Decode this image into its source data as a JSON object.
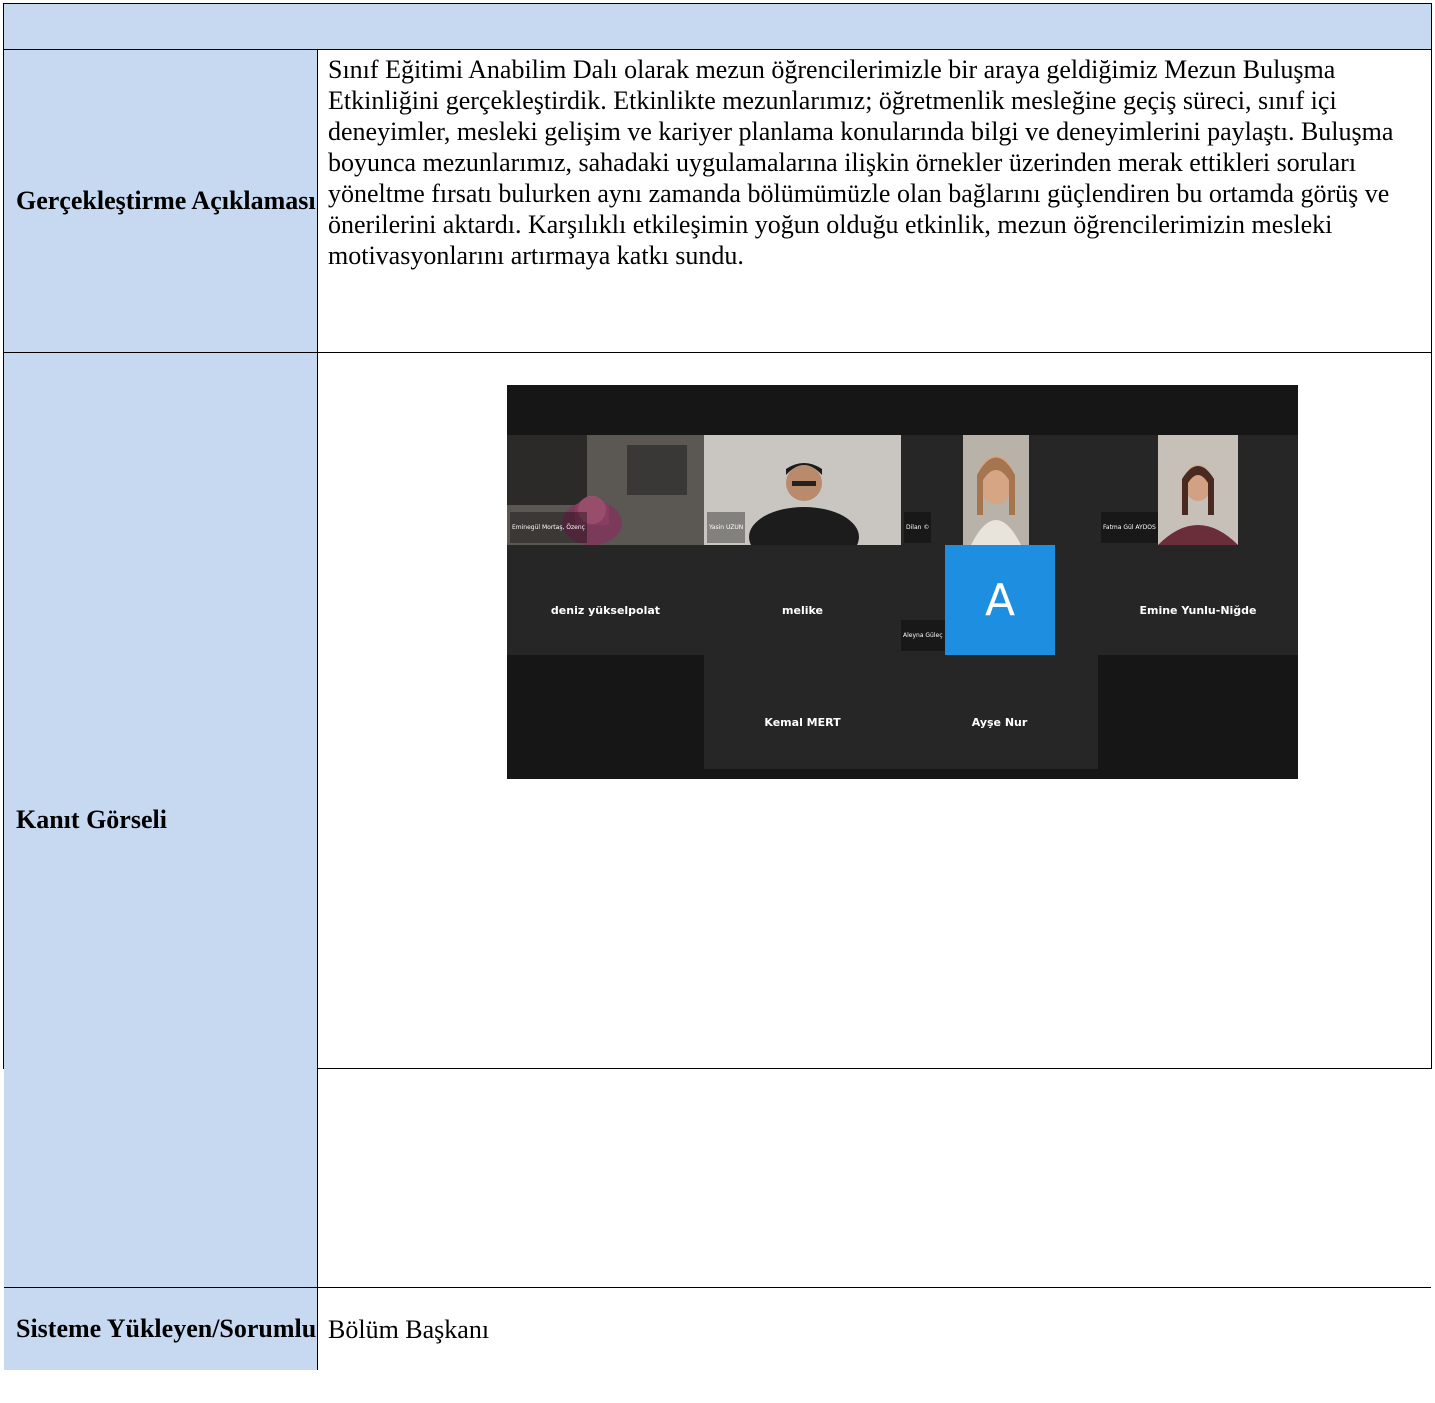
{
  "header": {
    "title": ""
  },
  "rows": {
    "description": {
      "label": "Gerçekleştirme Açıklaması",
      "text": "Sınıf Eğitimi Anabilim Dalı olarak mezun öğrencilerimizle bir araya geldiğimiz Mezun Buluşma Etkinliğini gerçekleştirdik. Etkinlikte mezunlarımız; öğretmenlik mesleğine geçiş süreci, sınıf içi deneyimler, mesleki gelişim ve kariyer planlama konularında bilgi ve deneyimlerini paylaştı. Buluşma boyunca mezunlarımız, sahadaki uygulamalarına ilişkin örnekler üzerinden merak ettikleri soruları yöneltme fırsatı bulurken aynı zamanda bölümümüzle olan bağlarını güçlendiren bu ortamda görüş ve önerilerini aktardı. Karşılıklı etkileşimin yoğun olduğu etkinlik, mezun öğrencilerimizin mesleki motivasyonlarını artırmaya katkı sundu."
    },
    "evidence": {
      "label": "Kanıt Görseli",
      "participants": {
        "video_1": "Eminegül Mortaş, Özenç",
        "video_2": "Yasin UZUN",
        "video_3": "Dilan ©",
        "video_4": "Fatma Gül AYDOS",
        "name_1": "deniz yükselpolat",
        "name_2": "melike",
        "avatar_letter": "A",
        "avatar_caption": "Aleyna Güleç",
        "name_3": "Emine Yunlu-Niğde",
        "name_4": "Kemal MERT",
        "name_5": "Ayşe Nur"
      }
    },
    "uploader": {
      "label": "Sisteme Yükleyen/Sorumlu",
      "value": "Bölüm Başkanı"
    }
  },
  "colors": {
    "label_background": "#c6d9f1",
    "evidence_background": "#161616",
    "avatar_blue": "#1e8fe0"
  }
}
